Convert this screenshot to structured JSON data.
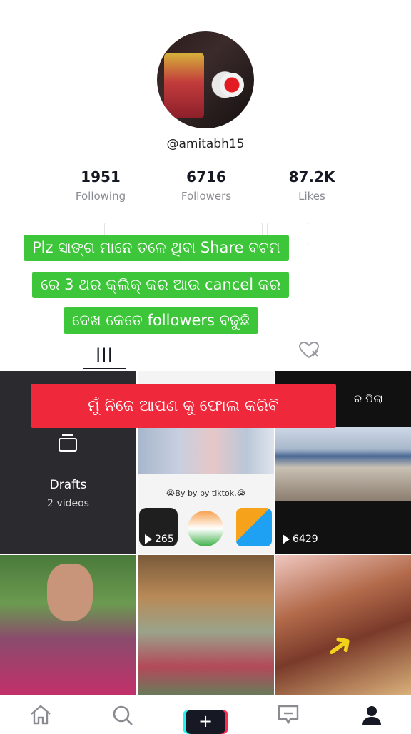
{
  "profile": {
    "handle": "@amitabh15",
    "stats": [
      {
        "value": "1951",
        "label": "Following"
      },
      {
        "value": "6716",
        "label": "Followers"
      },
      {
        "value": "87.2K",
        "label": "Likes"
      }
    ]
  },
  "overlay": {
    "green_lines": [
      "Plz ସାଙ୍ଗ ମାନେ ତଳେ ଥିବା Share ବଟମ",
      "ରେ 3 ଥର କ୍ଲିକ୍ କର ଆଉ cancel କର",
      "ଦେଖ କେତେ followers ବଢୁଛି"
    ],
    "red_line": "ମୁଁ ନିଜେ ଆପଣ କୁ ଫୋଲ କରିବି"
  },
  "tabs": {
    "grid_icon": "grid-icon",
    "liked_icon": "hidden-heart-icon"
  },
  "videos": {
    "drafts_title": "Drafts",
    "drafts_count": "2 videos",
    "cell2_caption": "😭By by by tiktok,😭",
    "cell2_views": "265",
    "cell3_label": "ର ପିଲା",
    "cell3_views": "6429"
  },
  "nav": {
    "items": [
      "home-icon",
      "search-icon",
      "create-icon",
      "inbox-icon",
      "profile-icon"
    ],
    "plus_symbol": "+"
  },
  "colors": {
    "green_banner": "#3ec63a",
    "red_banner": "#f0283c"
  }
}
